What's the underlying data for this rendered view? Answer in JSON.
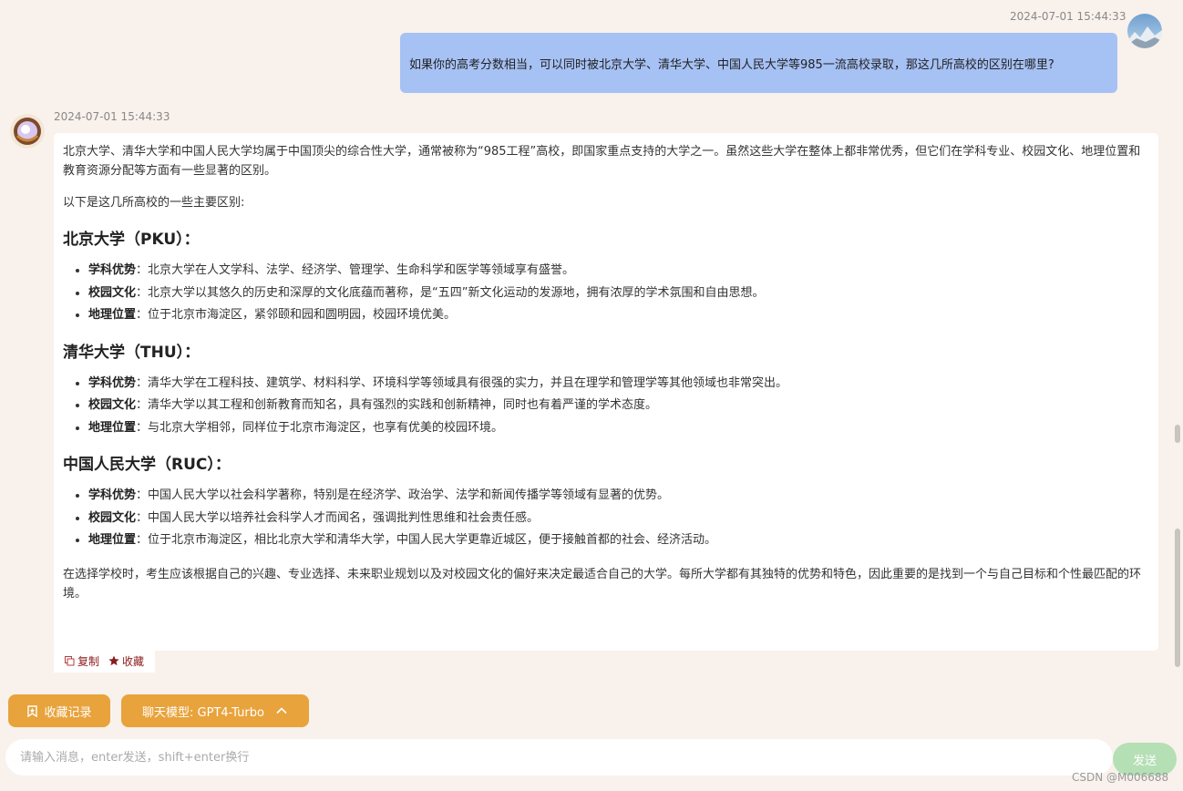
{
  "user_message": {
    "timestamp": "2024-07-01 15:44:33",
    "text": "如果你的高考分数相当，可以同时被北京大学、清华大学、中国人民大学等985一流高校录取，那这几所高校的区别在哪里?"
  },
  "ai_message": {
    "timestamp": "2024-07-01 15:44:33",
    "intro": "北京大学、清华大学和中国人民大学均属于中国顶尖的综合性大学，通常被称为“985工程”高校，即国家重点支持的大学之一。虽然这些大学在整体上都非常优秀，但它们在学科专业、校园文化、地理位置和教育资源分配等方面有一些显著的区别。",
    "lead": "以下是这几所高校的一些主要区别:",
    "sections": [
      {
        "heading": "北京大学（PKU）：",
        "items": [
          {
            "label": "学科优势",
            "text": "：北京大学在人文学科、法学、经济学、管理学、生命科学和医学等领域享有盛誉。"
          },
          {
            "label": "校园文化",
            "text": "：北京大学以其悠久的历史和深厚的文化底蕴而著称，是“五四”新文化运动的发源地，拥有浓厚的学术氛围和自由思想。"
          },
          {
            "label": "地理位置",
            "text": "：位于北京市海淀区，紧邻颐和园和圆明园，校园环境优美。"
          }
        ]
      },
      {
        "heading": "清华大学（THU）：",
        "items": [
          {
            "label": "学科优势",
            "text": "：清华大学在工程科技、建筑学、材料科学、环境科学等领域具有很强的实力，并且在理学和管理学等其他领域也非常突出。"
          },
          {
            "label": "校园文化",
            "text": "：清华大学以其工程和创新教育而知名，具有强烈的实践和创新精神，同时也有着严谨的学术态度。"
          },
          {
            "label": "地理位置",
            "text": "：与北京大学相邻，同样位于北京市海淀区，也享有优美的校园环境。"
          }
        ]
      },
      {
        "heading": "中国人民大学（RUC）：",
        "items": [
          {
            "label": "学科优势",
            "text": "：中国人民大学以社会科学著称，特别是在经济学、政治学、法学和新闻传播学等领域有显著的优势。"
          },
          {
            "label": "校园文化",
            "text": "：中国人民大学以培养社会科学人才而闻名，强调批判性思维和社会责任感。"
          },
          {
            "label": "地理位置",
            "text": "：位于北京市海淀区，相比北京大学和清华大学，中国人民大学更靠近城区，便于接触首都的社会、经济活动。"
          }
        ]
      }
    ],
    "conclusion": "在选择学校时，考生应该根据自己的兴趣、专业选择、未来职业规划以及对校园文化的偏好来决定最适合自己的大学。每所大学都有其独特的优势和特色，因此重要的是找到一个与自己目标和个性最匹配的环境。",
    "actions": {
      "copy": "复制",
      "favorite": "收藏"
    }
  },
  "toolbar": {
    "favorites_button": "收藏记录",
    "model_button": "聊天模型: GPT4-Turbo"
  },
  "input": {
    "placeholder": "请输入消息，enter发送，shift+enter换行",
    "value": "",
    "send_label": "发送"
  },
  "watermark": "CSDN @M006688",
  "colors": {
    "background": "#f9f1ec",
    "user_bubble": "#a6c1f4",
    "accent": "#e8a33c",
    "send_button": "#b5dfb5",
    "action_text": "#8b1b1b"
  },
  "icons": {
    "favorites_button": "bookmark-icon",
    "model_button": "chevron-up-icon",
    "copy": "copy-icon",
    "favorite": "star-icon"
  }
}
